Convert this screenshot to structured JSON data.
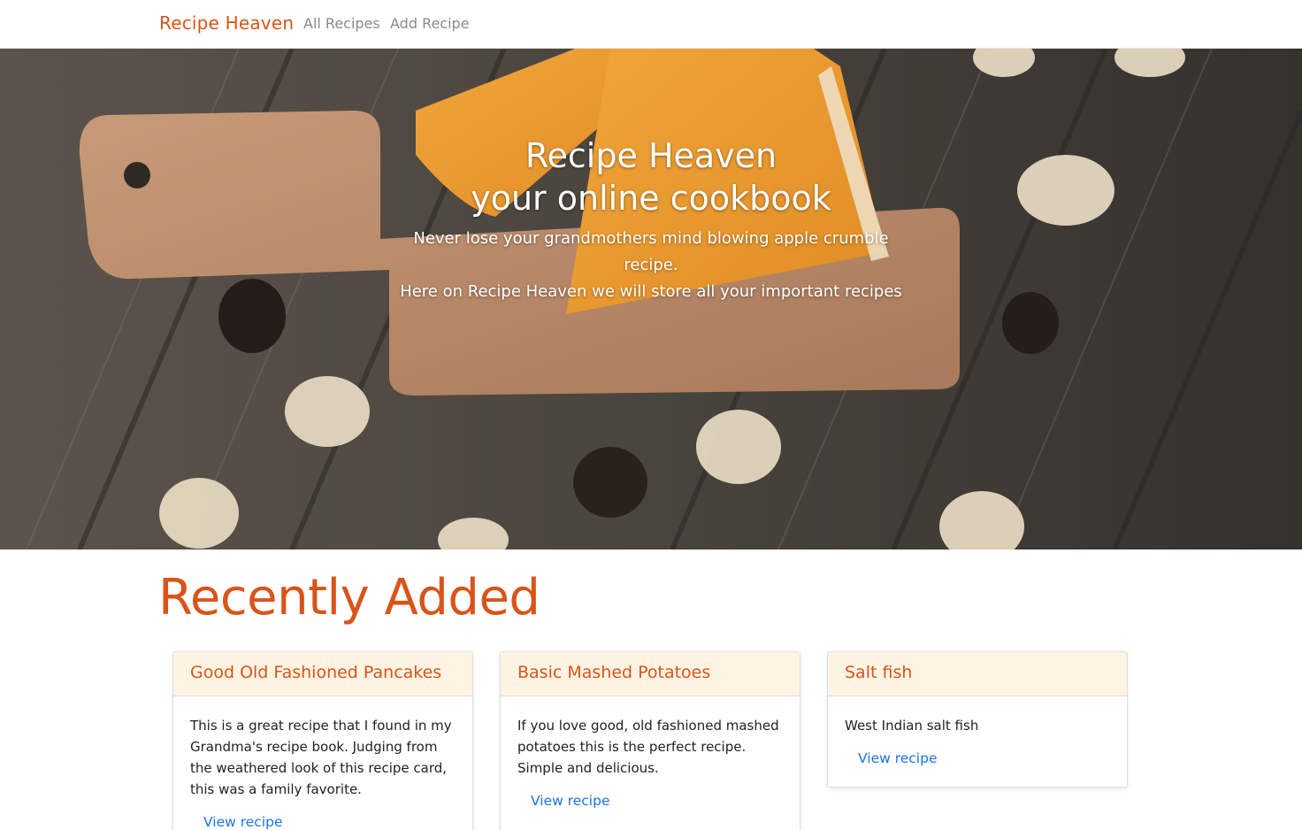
{
  "navbar": {
    "brand": "Recipe Heaven",
    "links": [
      "All Recipes",
      "Add Recipe"
    ]
  },
  "hero": {
    "title_line1": "Recipe Heaven",
    "title_line2": "your online cookbook",
    "subtitle_line1": "Never lose your grandmothers mind blowing apple crumble recipe.",
    "subtitle_line2": "Here on Recipe Heaven we will store all your important recipes"
  },
  "section": {
    "title": "Recently Added"
  },
  "cards": [
    {
      "title": "Good Old Fashioned Pancakes",
      "description": "This is a great recipe that I found in my Grandma's recipe book. Judging from the weathered look of this recipe card, this was a family favorite.",
      "link": "View recipe"
    },
    {
      "title": "Basic Mashed Potatoes",
      "description": "If you love good, old fashioned mashed potatoes this is the perfect recipe. Simple and delicious.",
      "link": "View recipe"
    },
    {
      "title": "Salt fish",
      "description": "West Indian salt fish",
      "link": "View recipe"
    }
  ],
  "colors": {
    "accent": "#d9541a",
    "link": "#1a73e8",
    "card_header": "#fff4e4"
  }
}
